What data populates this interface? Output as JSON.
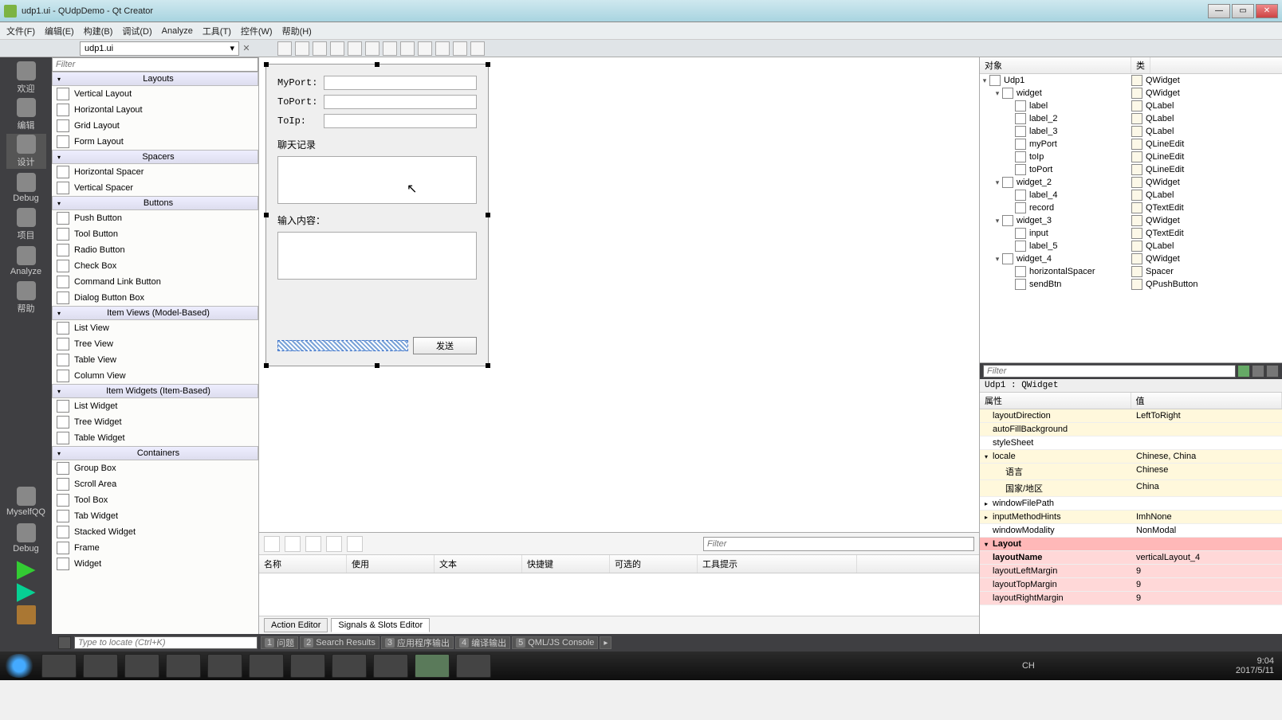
{
  "titlebar": {
    "title": "udp1.ui - QUdpDemo - Qt Creator"
  },
  "menubar": [
    "文件(F)",
    "编辑(E)",
    "构建(B)",
    "调试(D)",
    "Analyze",
    "工具(T)",
    "控件(W)",
    "帮助(H)"
  ],
  "opentab": "udp1.ui",
  "leftstrip": [
    {
      "label": "欢迎"
    },
    {
      "label": "编辑"
    },
    {
      "label": "设计",
      "active": true
    },
    {
      "label": "Debug"
    },
    {
      "label": "项目"
    },
    {
      "label": "Analyze"
    },
    {
      "label": "帮助"
    },
    {
      "label": "MyselfQQ"
    },
    {
      "label": "Debug"
    }
  ],
  "widgetbox": {
    "filter_placeholder": "Filter",
    "categories": [
      {
        "name": "Layouts",
        "items": [
          "Vertical Layout",
          "Horizontal Layout",
          "Grid Layout",
          "Form Layout"
        ]
      },
      {
        "name": "Spacers",
        "items": [
          "Horizontal Spacer",
          "Vertical Spacer"
        ]
      },
      {
        "name": "Buttons",
        "items": [
          "Push Button",
          "Tool Button",
          "Radio Button",
          "Check Box",
          "Command Link Button",
          "Dialog Button Box"
        ]
      },
      {
        "name": "Item Views (Model-Based)",
        "items": [
          "List View",
          "Tree View",
          "Table View",
          "Column View"
        ]
      },
      {
        "name": "Item Widgets (Item-Based)",
        "items": [
          "List Widget",
          "Tree Widget",
          "Table Widget"
        ]
      },
      {
        "name": "Containers",
        "items": [
          "Group Box",
          "Scroll Area",
          "Tool Box",
          "Tab Widget",
          "Stacked Widget",
          "Frame",
          "Widget"
        ]
      }
    ]
  },
  "form": {
    "labels": {
      "myport": "MyPort:",
      "toport": "ToPort:",
      "toip": "ToIp:",
      "chat": "聊天记录",
      "input": "输入内容："
    },
    "send_btn": "发送"
  },
  "action_editor": {
    "filter_placeholder": "Filter",
    "columns": [
      "名称",
      "使用",
      "文本",
      "快捷键",
      "可选的",
      "工具提示"
    ],
    "tabs": [
      "Action Editor",
      "Signals & Slots Editor"
    ]
  },
  "object_inspector": {
    "headers": [
      "对象",
      "类"
    ],
    "tree": [
      {
        "indent": 0,
        "exp": "▾",
        "name": "Udp1",
        "class": "QWidget"
      },
      {
        "indent": 1,
        "exp": "▾",
        "name": "widget",
        "class": "QWidget"
      },
      {
        "indent": 2,
        "exp": "",
        "name": "label",
        "class": "QLabel"
      },
      {
        "indent": 2,
        "exp": "",
        "name": "label_2",
        "class": "QLabel"
      },
      {
        "indent": 2,
        "exp": "",
        "name": "label_3",
        "class": "QLabel"
      },
      {
        "indent": 2,
        "exp": "",
        "name": "myPort",
        "class": "QLineEdit"
      },
      {
        "indent": 2,
        "exp": "",
        "name": "toIp",
        "class": "QLineEdit"
      },
      {
        "indent": 2,
        "exp": "",
        "name": "toPort",
        "class": "QLineEdit"
      },
      {
        "indent": 1,
        "exp": "▾",
        "name": "widget_2",
        "class": "QWidget"
      },
      {
        "indent": 2,
        "exp": "",
        "name": "label_4",
        "class": "QLabel"
      },
      {
        "indent": 2,
        "exp": "",
        "name": "record",
        "class": "QTextEdit"
      },
      {
        "indent": 1,
        "exp": "▾",
        "name": "widget_3",
        "class": "QWidget"
      },
      {
        "indent": 2,
        "exp": "",
        "name": "input",
        "class": "QTextEdit"
      },
      {
        "indent": 2,
        "exp": "",
        "name": "label_5",
        "class": "QLabel"
      },
      {
        "indent": 1,
        "exp": "▾",
        "name": "widget_4",
        "class": "QWidget"
      },
      {
        "indent": 2,
        "exp": "",
        "name": "horizontalSpacer",
        "class": "Spacer"
      },
      {
        "indent": 2,
        "exp": "",
        "name": "sendBtn",
        "class": "QPushButton"
      }
    ]
  },
  "property_editor": {
    "filter_placeholder": "Filter",
    "title": "Udp1 : QWidget",
    "headers": [
      "属性",
      "值"
    ],
    "rows": [
      {
        "name": "layoutDirection",
        "value": "LeftToRight",
        "cls": "yellow"
      },
      {
        "name": "autoFillBackground",
        "value": "",
        "cls": "yellow"
      },
      {
        "name": "styleSheet",
        "value": "",
        "cls": ""
      },
      {
        "name": "locale",
        "value": "Chinese, China",
        "cls": "yellow",
        "exp": "▾"
      },
      {
        "name": "语言",
        "value": "Chinese",
        "cls": "yellow",
        "indent": 1
      },
      {
        "name": "国家/地区",
        "value": "China",
        "cls": "yellow",
        "indent": 1
      },
      {
        "name": "windowFilePath",
        "value": "",
        "cls": "",
        "exp": "▸"
      },
      {
        "name": "inputMethodHints",
        "value": "ImhNone",
        "cls": "yellow",
        "exp": "▸"
      },
      {
        "name": "windowModality",
        "value": "NonModal",
        "cls": ""
      },
      {
        "name": "Layout",
        "value": "",
        "cls": "pink-header",
        "exp": "▾"
      },
      {
        "name": "layoutName",
        "value": "verticalLayout_4",
        "cls": "pink",
        "bold": true
      },
      {
        "name": "layoutLeftMargin",
        "value": "9",
        "cls": "pink"
      },
      {
        "name": "layoutTopMargin",
        "value": "9",
        "cls": "pink"
      },
      {
        "name": "layoutRightMargin",
        "value": "9",
        "cls": "pink"
      }
    ]
  },
  "bottombar": {
    "locator_placeholder": "Type to locate (Ctrl+K)",
    "tabs": [
      {
        "num": "1",
        "label": "问题"
      },
      {
        "num": "2",
        "label": "Search Results"
      },
      {
        "num": "3",
        "label": "应用程序输出"
      },
      {
        "num": "4",
        "label": "编译输出"
      },
      {
        "num": "5",
        "label": "QML/JS Console"
      }
    ]
  },
  "tray": {
    "ime": "CH",
    "time": "9:04",
    "date": "2017/5/11"
  }
}
